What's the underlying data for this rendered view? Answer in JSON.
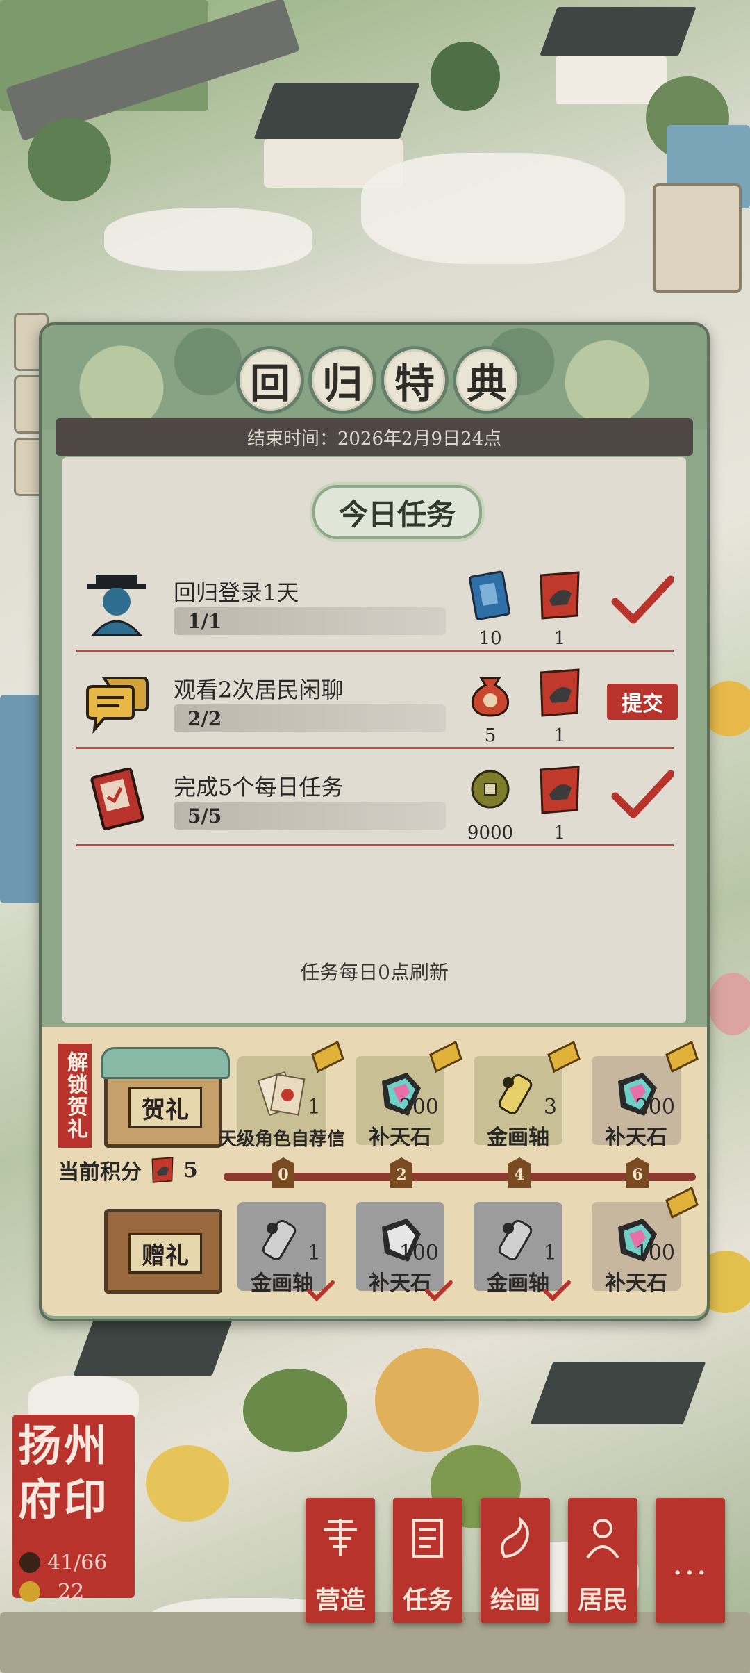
{
  "event": {
    "title_chars": [
      "回",
      "归",
      "特",
      "典"
    ],
    "end_time": "结束时间：2026年2月9日24点"
  },
  "daily": {
    "heading": "今日任务",
    "tasks": [
      {
        "title": "回归登录1天",
        "progress": "1/1",
        "progress_fraction": 1.0,
        "icon": "official-avatar-icon",
        "rewards": [
          {
            "icon": "blue-ticket-icon",
            "count": "10"
          },
          {
            "icon": "red-scroll-icon",
            "count": "1"
          }
        ],
        "state": "claimed"
      },
      {
        "title": "观看2次居民闲聊",
        "progress": "2/2",
        "progress_fraction": 1.0,
        "icon": "chat-bubbles-icon",
        "rewards": [
          {
            "icon": "money-bag-icon",
            "count": "5"
          },
          {
            "icon": "red-scroll-icon",
            "count": "1"
          }
        ],
        "state": "submit",
        "submit_label": "提交"
      },
      {
        "title": "完成5个每日任务",
        "progress": "5/5",
        "progress_fraction": 1.0,
        "icon": "task-book-icon",
        "rewards": [
          {
            "icon": "copper-coin-icon",
            "count": "9000"
          },
          {
            "icon": "red-scroll-icon",
            "count": "1"
          }
        ],
        "state": "claimed"
      }
    ],
    "refresh_note": "任务每日0点刷新"
  },
  "rewards": {
    "unlock_label": "解锁贺礼",
    "premium_label": "贺礼",
    "free_label": "赠礼",
    "points_label": "当前积分",
    "points_value": "5",
    "milestones": [
      "0",
      "2",
      "4",
      "6"
    ],
    "premium_items": [
      {
        "name": "天级角色自荐信",
        "amount": "1",
        "icon": "letter-icon"
      },
      {
        "name": "补天石",
        "amount": "200",
        "icon": "gem-icon"
      },
      {
        "name": "金画轴",
        "amount": "3",
        "icon": "scroll-icon"
      },
      {
        "name": "补天石",
        "amount": "200",
        "icon": "gem-icon"
      }
    ],
    "free_items": [
      {
        "name": "金画轴",
        "amount": "1",
        "icon": "scroll-icon",
        "claimed": true
      },
      {
        "name": "补天石",
        "amount": "100",
        "icon": "gem-icon",
        "claimed": true
      },
      {
        "name": "金画轴",
        "amount": "1",
        "icon": "scroll-icon",
        "claimed": true
      },
      {
        "name": "补天石",
        "amount": "100",
        "icon": "gem-icon",
        "claimed": false
      }
    ]
  },
  "hud": {
    "seal_text": "扬州府印",
    "population": "41/66",
    "coins": "_22",
    "buttons": [
      {
        "label": "营造",
        "icon": "build-icon"
      },
      {
        "label": "任务",
        "icon": "task-icon"
      },
      {
        "label": "绘画",
        "icon": "painting-icon"
      },
      {
        "label": "居民",
        "icon": "resident-icon"
      },
      {
        "label": "",
        "icon": "more-icon"
      }
    ]
  },
  "colors": {
    "accent_red": "#b8332b",
    "panel_green": "#8fa889",
    "paper": "#e1dcd2"
  }
}
